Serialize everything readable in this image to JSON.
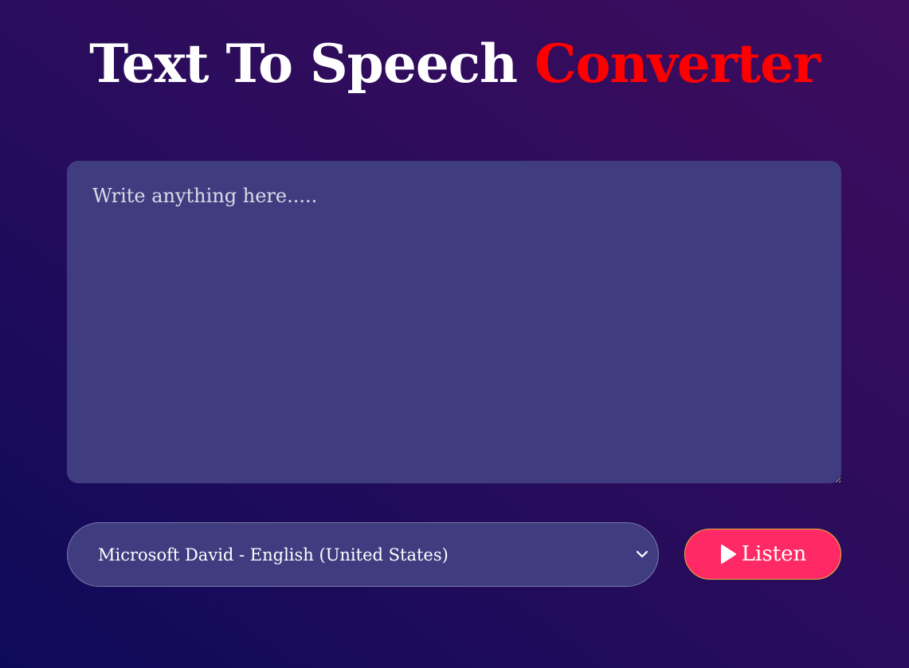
{
  "heading": {
    "part1": "Text To Speech",
    "part2": "Converter"
  },
  "text_input": {
    "placeholder": "Write anything here.....",
    "value": ""
  },
  "voice_select": {
    "selected": "Microsoft David - English (United States)",
    "icon": "chevron-down-icon"
  },
  "listen_button": {
    "label": "Listen",
    "icon": "play-icon"
  },
  "colors": {
    "background_start": "#0e0a5a",
    "background_end": "#3e0c5e",
    "accent_red": "#ff0000",
    "panel": "#3f3d80",
    "button": "#ff2a65"
  }
}
